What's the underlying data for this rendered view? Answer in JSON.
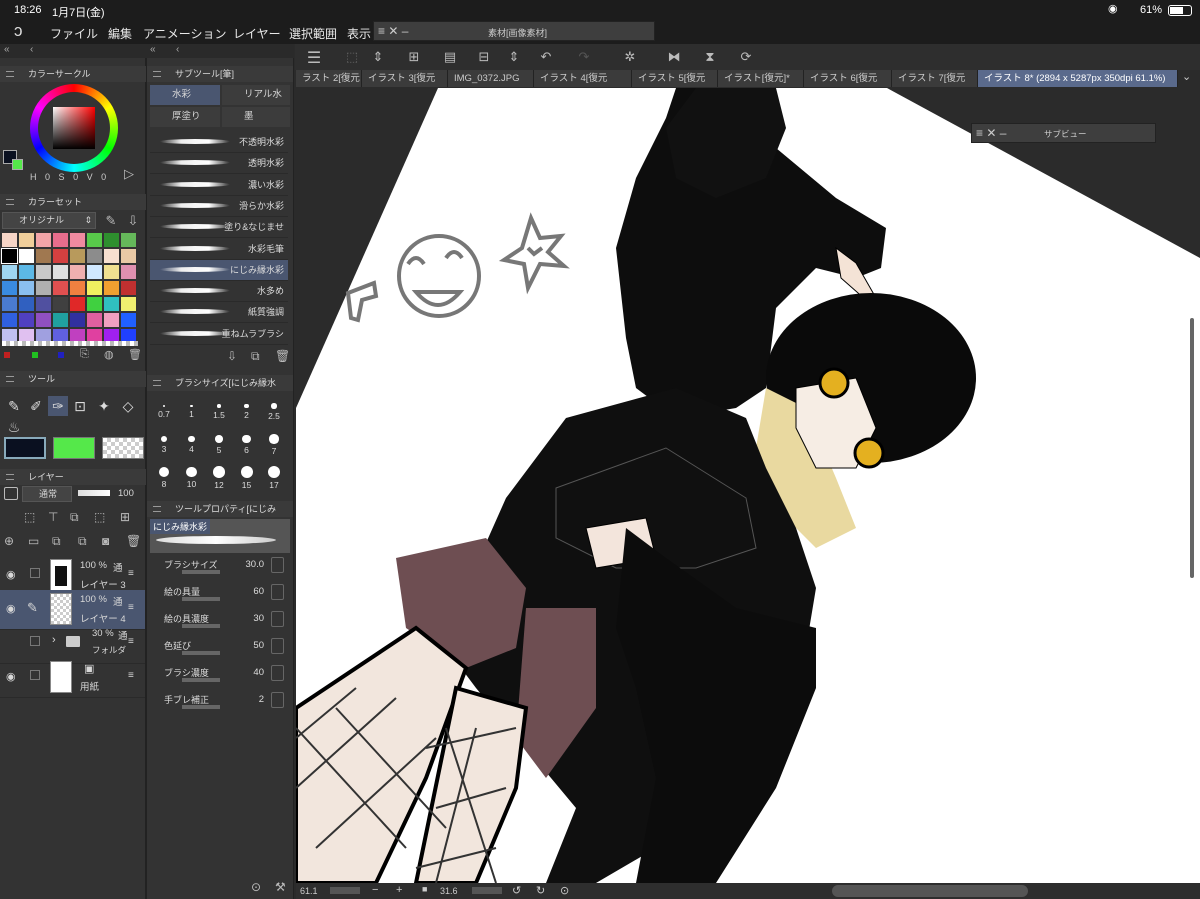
{
  "status": {
    "time": "18:26",
    "date": "1月7日(金)",
    "battery": "61%"
  },
  "menu": [
    "ファイル",
    "編集",
    "アニメーション",
    "レイヤー",
    "選択範囲",
    "表示"
  ],
  "material_window": {
    "title": "素材[画像素材]"
  },
  "subview_window": {
    "title": "サブビュー"
  },
  "tabs": [
    "ラスト 2[復元",
    "イラスト 3[復元",
    "IMG_0372.JPG",
    "イラスト 4[復元",
    "イラスト 5[復元",
    "イラスト[復元]*",
    "イラスト 6[復元",
    "イラスト 7[復元",
    "イラスト 8* (2894 x 5287px 350dpi 61.1%)"
  ],
  "color_circle": {
    "title": "カラーサークル",
    "readout": [
      "H",
      "0",
      "S",
      "0",
      "V",
      "0"
    ]
  },
  "color_set": {
    "title": "カラーセット",
    "set_name": "オリジナル",
    "swatches": [
      "#f6d5c6",
      "#f0cf9b",
      "#f2a5a8",
      "#e86d8c",
      "#f08aa0",
      "#58c94a",
      "#2e8f2e",
      "#65b85a",
      "#000000",
      "#ffffff",
      "#a07850",
      "#d44040",
      "#b89a5c",
      "#8c8c8c",
      "#f7e0d0",
      "#e9c9a5",
      "#9fd6f2",
      "#5cb8e6",
      "#c8c8c8",
      "#e0e0e0",
      "#f0b0b0",
      "#d0e8ff",
      "#f0e090",
      "#e090b0",
      "#3a8be0",
      "#8abff0",
      "#b0b0b0",
      "#e05050",
      "#f08040",
      "#f0f060",
      "#f0a030",
      "#c03030",
      "#4a7bd0",
      "#3060c0",
      "#5050a0",
      "#404040",
      "#e02828",
      "#40d040",
      "#30c0c0",
      "#f0f070",
      "#3060e0",
      "#5040c0",
      "#9050c0",
      "#20a0a0",
      "#3030a0",
      "#e060a0",
      "#f0a0c0",
      "#2060ff",
      "#c0c0f0",
      "#e0c0f0",
      "#a0a0e0",
      "#6060e0",
      "#c040c0",
      "#e040a0",
      "#a020f0",
      "#2040ff"
    ]
  },
  "subtool": {
    "title": "サブツール[筆]",
    "groups": [
      "水彩",
      "リアル水彩",
      "厚塗り",
      "墨"
    ],
    "brushes": [
      "不透明水彩",
      "透明水彩",
      "濃い水彩",
      "滑らか水彩",
      "塗り&なじませ",
      "水彩毛筆",
      "にじみ縁水彩",
      "水多め",
      "紙質強調",
      "重ねムラブラシ"
    ]
  },
  "tool": {
    "title": "ツール"
  },
  "brush_size": {
    "title": "ブラシサイズ[にじみ縁水",
    "sizes": [
      "0.7",
      "1",
      "1.5",
      "2",
      "2.5",
      "3",
      "4",
      "5",
      "6",
      "7",
      "8",
      "10",
      "12",
      "15",
      "17"
    ]
  },
  "layers": {
    "title": "レイヤー",
    "blend": "通常",
    "opacity": "100",
    "items": [
      {
        "opacity": "100 %",
        "mode": "通",
        "name": "レイヤー 3"
      },
      {
        "opacity": "100 %",
        "mode": "通",
        "name": "レイヤー 4"
      },
      {
        "opacity": "30 %",
        "mode": "通",
        "name": "フォルダ"
      },
      {
        "opacity": "",
        "mode": "",
        "name": "用紙"
      }
    ]
  },
  "tool_property": {
    "title": "ツールプロパティ[にじみ",
    "brush_name": "にじみ縁水彩",
    "props": [
      {
        "label": "ブラシサイズ",
        "value": "30.0"
      },
      {
        "label": "絵の具量",
        "value": "60"
      },
      {
        "label": "絵の具濃度",
        "value": "30"
      },
      {
        "label": "色延び",
        "value": "50"
      },
      {
        "label": "ブラシ濃度",
        "value": "40"
      },
      {
        "label": "手ブレ補正",
        "value": "2"
      }
    ]
  },
  "bottom": {
    "zoom": "61.1",
    "angle": "31.6"
  },
  "colors": {
    "accent": "#5a6a8c",
    "panel": "#333333",
    "main_color": "#1a1a1a",
    "sub_color": "#55e84a"
  }
}
